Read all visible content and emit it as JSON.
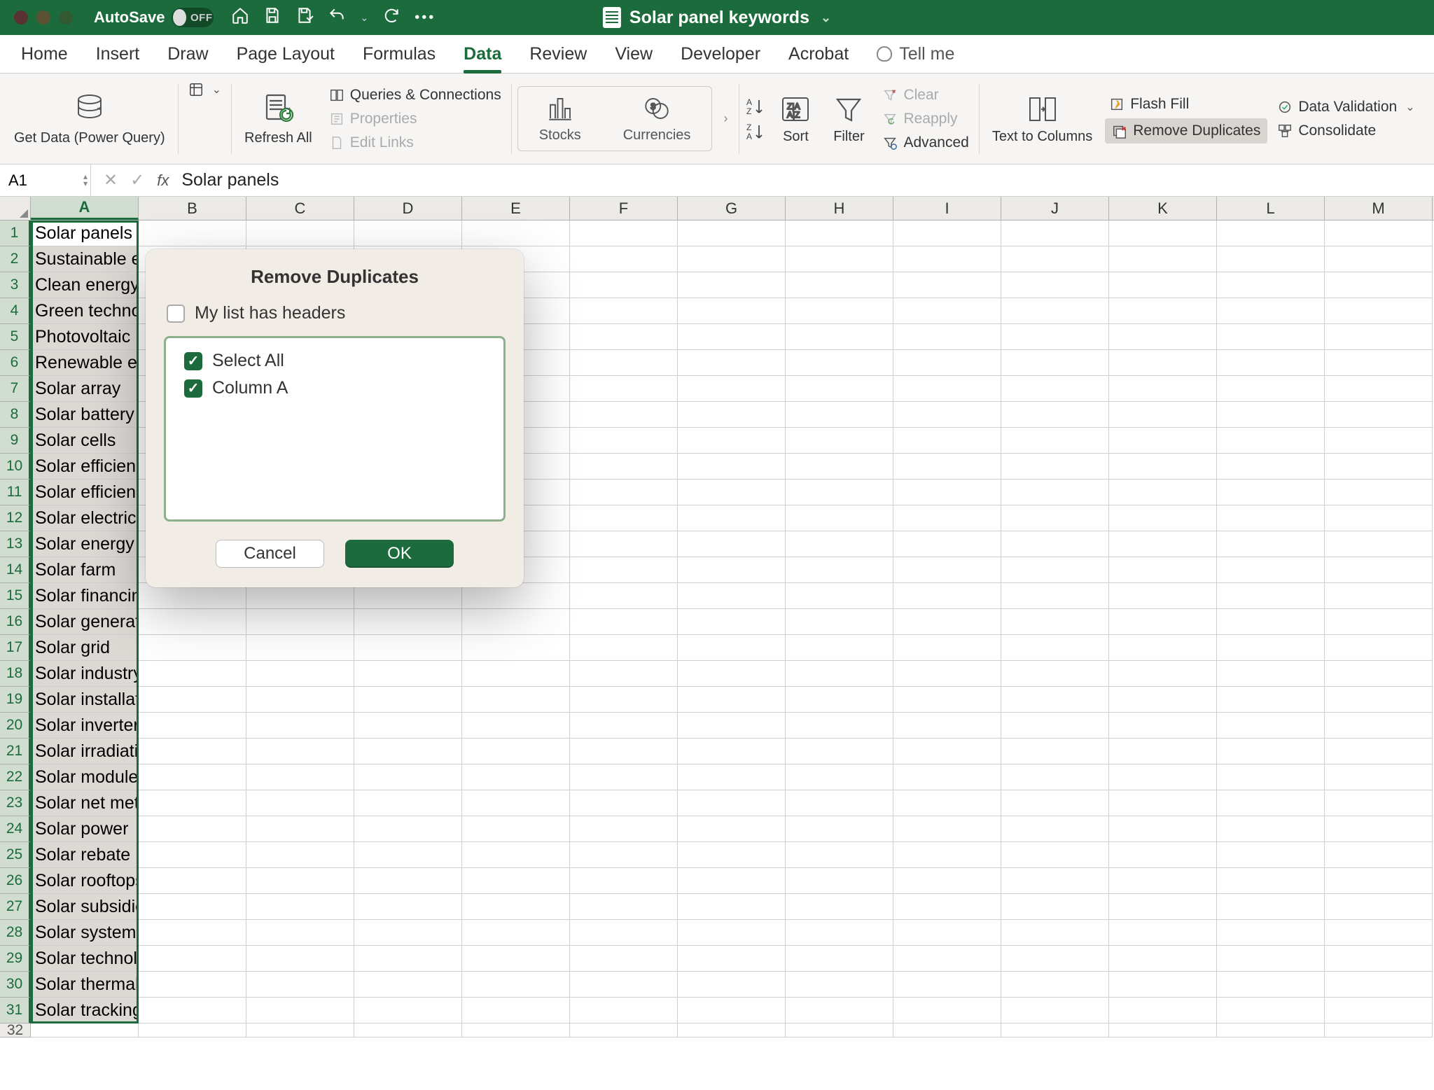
{
  "titlebar": {
    "autosave_label": "AutoSave",
    "autosave_state": "OFF",
    "doc_title": "Solar panel keywords"
  },
  "tabs": [
    "Home",
    "Insert",
    "Draw",
    "Page Layout",
    "Formulas",
    "Data",
    "Review",
    "View",
    "Developer",
    "Acrobat"
  ],
  "active_tab": "Data",
  "tellme": "Tell me",
  "ribbon": {
    "get_data": "Get Data (Power Query)",
    "refresh": "Refresh All",
    "queries": "Queries & Connections",
    "properties": "Properties",
    "edit_links": "Edit Links",
    "stocks": "Stocks",
    "currencies": "Currencies",
    "sort": "Sort",
    "filter": "Filter",
    "clear": "Clear",
    "reapply": "Reapply",
    "advanced": "Advanced",
    "text_to_columns": "Text to Columns",
    "flash_fill": "Flash Fill",
    "remove_dupes": "Remove Duplicates",
    "data_validation": "Data Validation",
    "consolidate": "Consolidate"
  },
  "formula_bar": {
    "name": "A1",
    "value": "Solar panels"
  },
  "columns": [
    "A",
    "B",
    "C",
    "D",
    "E",
    "F",
    "G",
    "H",
    "I",
    "J",
    "K",
    "L",
    "M"
  ],
  "col_widths": {
    "A": 154,
    "other": 154
  },
  "rows": [
    "Solar panels",
    "Sustainable energy",
    "Clean energy",
    "Green technology",
    "Photovoltaic",
    "Renewable energy",
    "Solar array",
    "Solar battery",
    "Solar cells",
    "Solar efficiency",
    "Solar efficiency",
    "Solar electric",
    "Solar energy",
    "Solar farm",
    "Solar financing",
    "Solar generation",
    "Solar grid",
    "Solar industry",
    "Solar installation",
    "Solar inverter",
    "Solar irradiation",
    "Solar modules",
    "Solar net metering",
    "Solar power",
    "Solar rebate",
    "Solar rooftops",
    "Solar subsidies",
    "Solar system",
    "Solar technology",
    "Solar thermal",
    "Solar tracking"
  ],
  "dialog": {
    "title": "Remove Duplicates",
    "headers_label": "My list has headers",
    "select_all": "Select All",
    "column_a": "Column A",
    "cancel": "Cancel",
    "ok": "OK"
  }
}
